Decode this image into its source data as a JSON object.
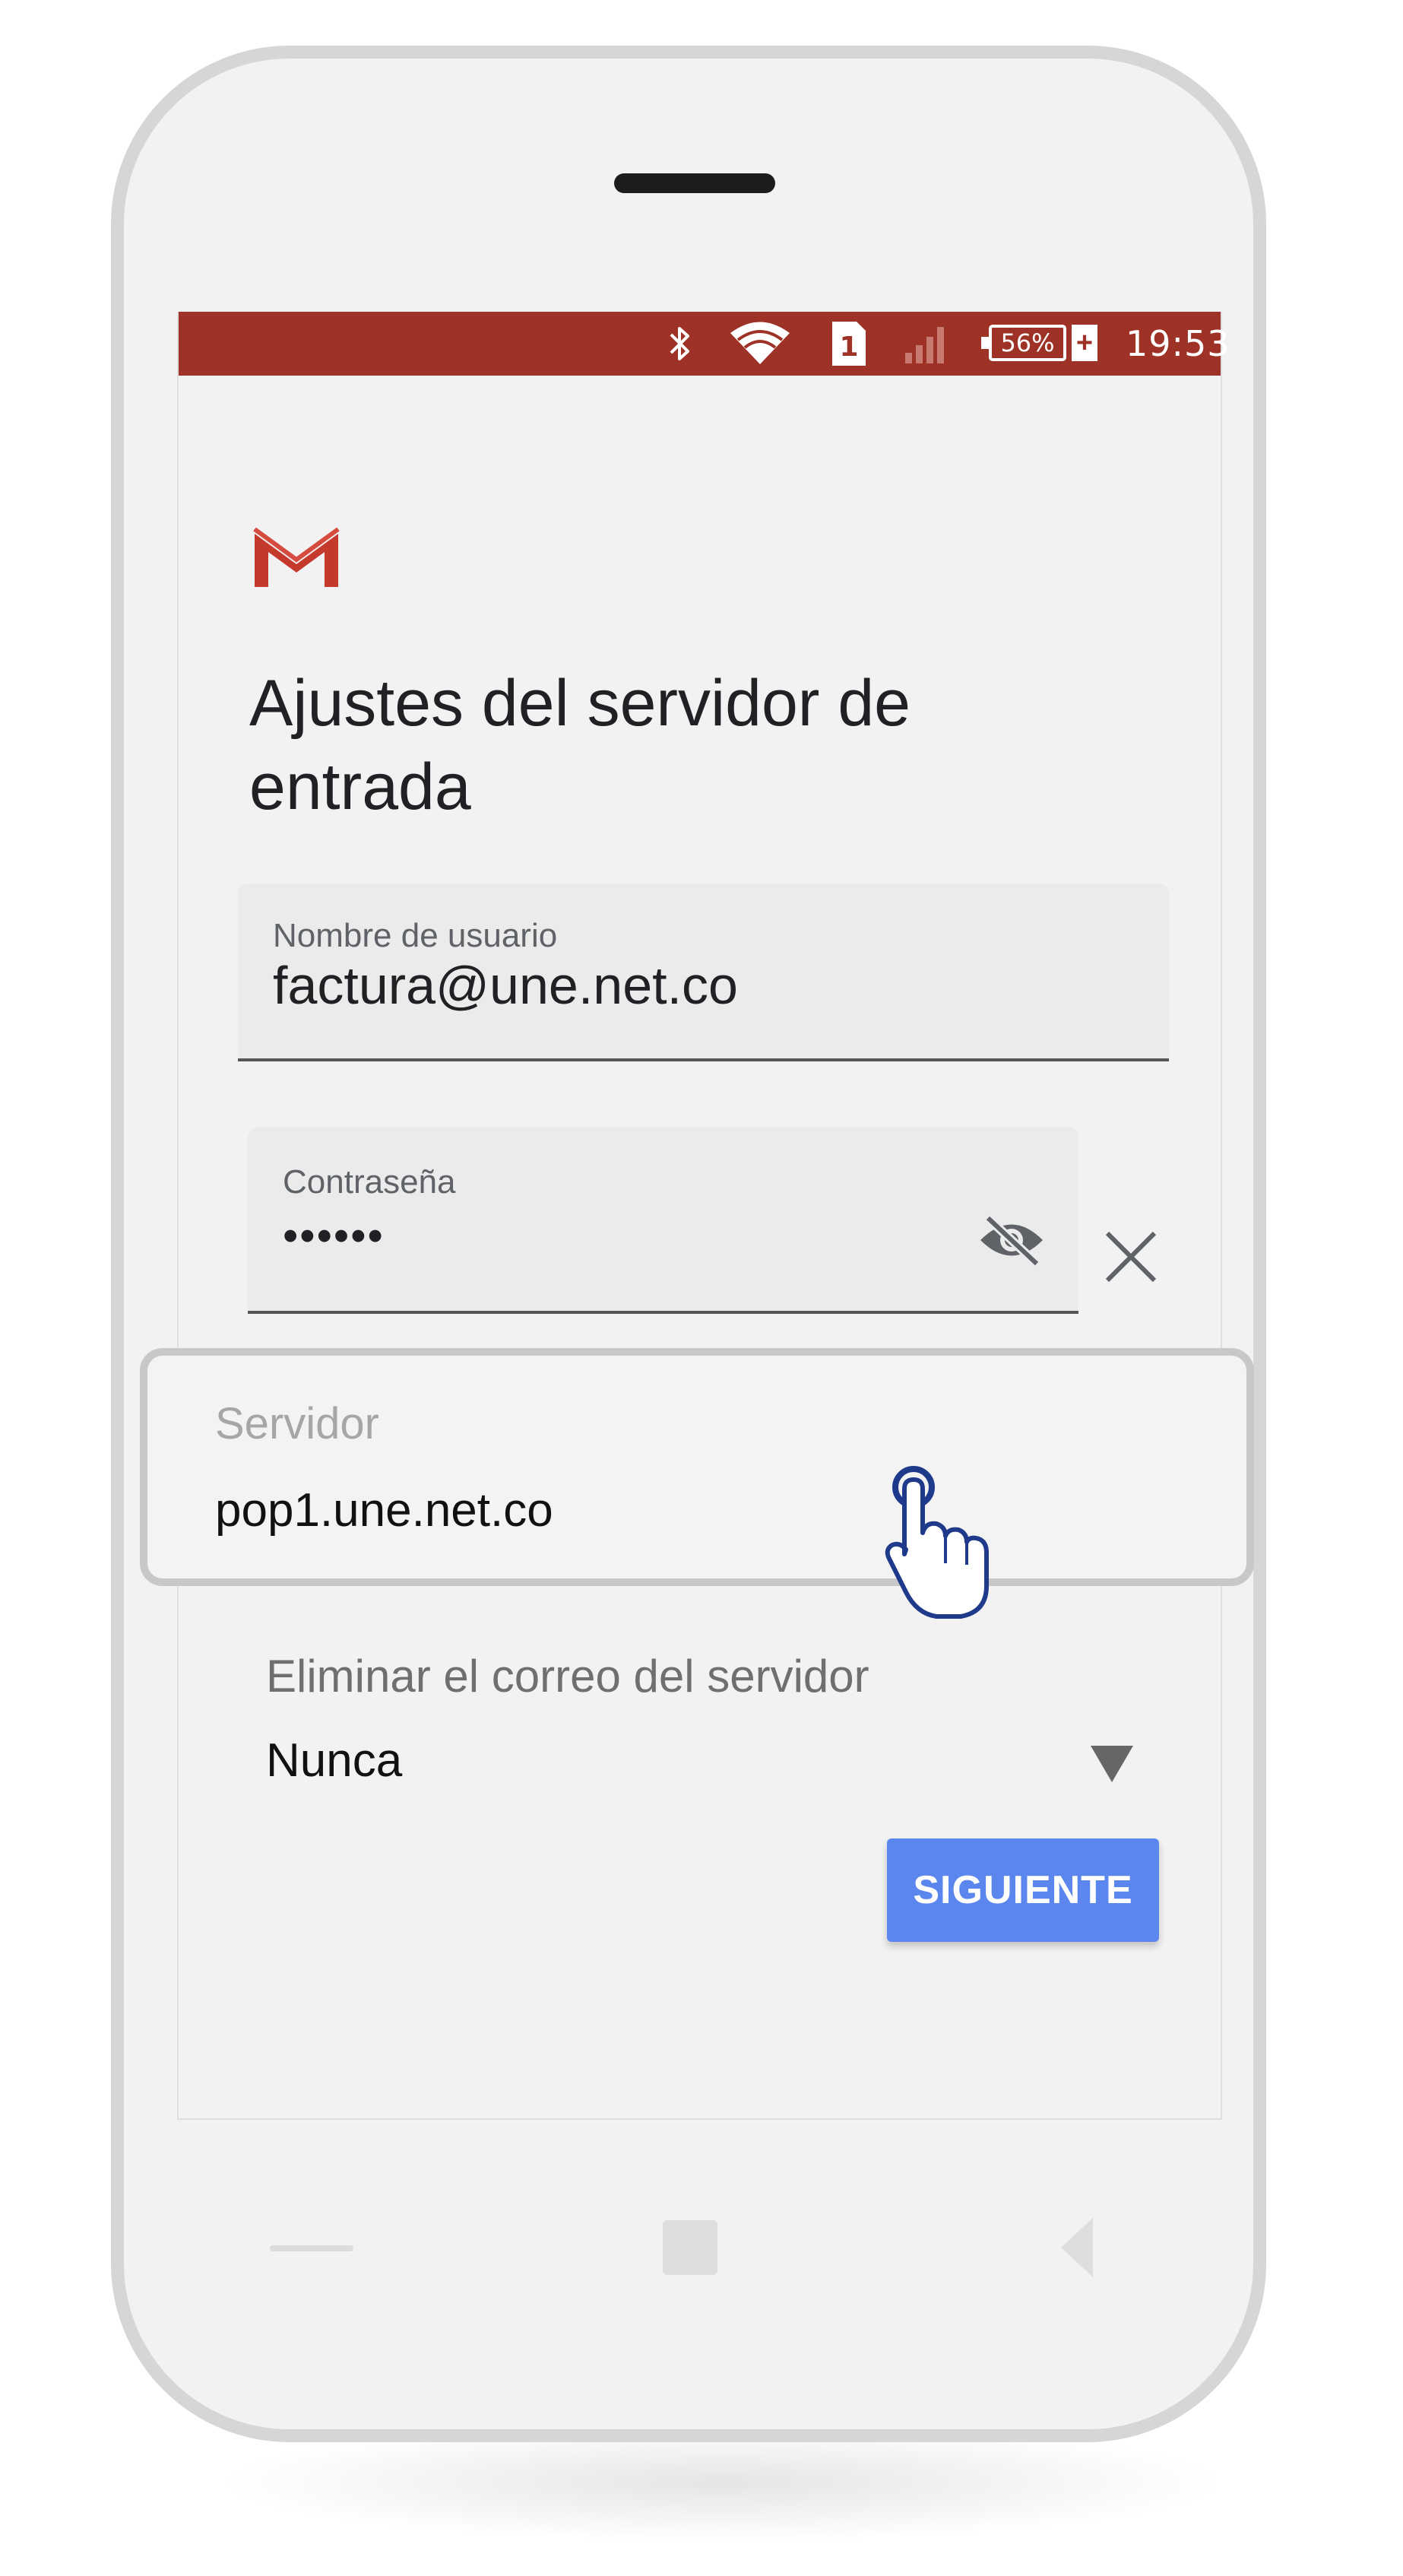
{
  "status_bar": {
    "battery": "56%",
    "sim_slot": "1",
    "time": "19:53",
    "background_color": "#9e3227",
    "icons": [
      "bluetooth-icon",
      "wifi-icon",
      "sim-card-icon",
      "signal-icon",
      "battery-icon"
    ]
  },
  "app": {
    "logo": "gmail-logo",
    "title": "Ajustes del servidor de entrada"
  },
  "username_field": {
    "label": "Nombre de usuario",
    "value": "factura@une.net.co"
  },
  "password_field": {
    "label": "Contraseña",
    "value": "••••••",
    "toggle_icon": "visibility-off-icon",
    "clear_icon": "close-icon"
  },
  "server_field": {
    "label": "Servidor",
    "value": "pop1.une.net.co",
    "pointer_icon": "hand-pointer-icon"
  },
  "delete_setting": {
    "label": "Eliminar el correo del servidor",
    "value": "Nunca"
  },
  "next_button": {
    "label": "SIGUIENTE",
    "color": "#5b86ee"
  },
  "nav_bar": {
    "icons": [
      "recent-apps-icon",
      "home-icon",
      "back-icon"
    ]
  }
}
